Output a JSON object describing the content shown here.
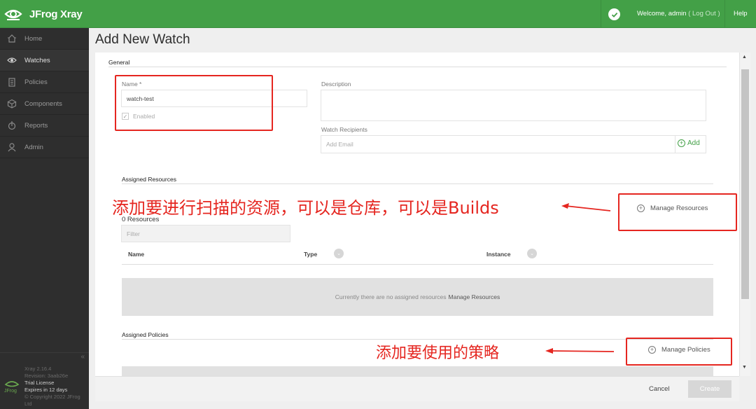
{
  "header": {
    "brand": "JFrog Xray",
    "welcome_prefix": "Welcome, admin",
    "logout": "( Log Out )",
    "help": "Help"
  },
  "sidebar": {
    "items": [
      {
        "label": "Home",
        "icon": "home-icon"
      },
      {
        "label": "Watches",
        "icon": "eye-icon"
      },
      {
        "label": "Policies",
        "icon": "clipboard-icon"
      },
      {
        "label": "Components",
        "icon": "cube-icon"
      },
      {
        "label": "Reports",
        "icon": "reports-icon"
      },
      {
        "label": "Admin",
        "icon": "admin-icon"
      }
    ],
    "active": "Watches",
    "collapse_glyph": "«",
    "footer": {
      "version": "Xray 2.16.4",
      "revision": "Revision: 3aab26e",
      "license": "Trial License",
      "expires": "Expires in 12 days",
      "copyright_1": "© Copyright 2022 JFrog",
      "copyright_2": "Ltd"
    }
  },
  "page": {
    "title": "Add New Watch",
    "general": {
      "section_label": "General",
      "name_label": "Name *",
      "name_value": "watch-test",
      "enabled_label": "Enabled",
      "enabled_checked": true,
      "description_label": "Description",
      "description_value": "",
      "recipients_label": "Watch Recipients",
      "recipients_placeholder": "Add Email",
      "add_label": "Add"
    },
    "resources": {
      "section_label": "Assigned Resources",
      "manage_label": "Manage Resources",
      "count_label": "0 Resources",
      "filter_placeholder": "Filter",
      "columns": [
        "Name",
        "Type",
        "Instance"
      ],
      "empty_text": "Currently there are no assigned resources",
      "empty_link": "Manage Resources"
    },
    "policies": {
      "section_label": "Assigned Policies",
      "manage_label": "Manage Policies"
    },
    "footer": {
      "cancel": "Cancel",
      "create": "Create"
    }
  },
  "annotations": {
    "resources_note": "添加要进行扫描的资源，可以是仓库，可以是Builds",
    "policies_note": "添加要使用的策略",
    "color": "#e52620"
  },
  "colors": {
    "brand_green": "#43a047",
    "sidebar_bg": "#2e2e2e"
  }
}
